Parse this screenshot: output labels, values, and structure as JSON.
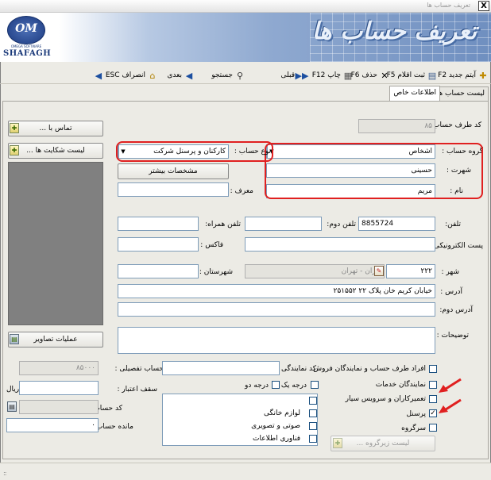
{
  "window": {
    "title": "تعریف حساب ها",
    "close_label": "X"
  },
  "banner": {
    "title": "تعریف حساب ها",
    "logo_letters": "OM",
    "logo_sub": "OMEGA SOFTWARE",
    "logo_name": "SHAFAGH"
  },
  "toolbar": {
    "items": [
      {
        "icon": "new-icon",
        "label": "آیتم جدید F2"
      },
      {
        "icon": "register-icon",
        "label": "ثبت اقلام F5"
      },
      {
        "icon": "delete-icon",
        "label": "حذف F6"
      },
      {
        "icon": "print-icon",
        "label": "چاپ F12"
      },
      {
        "icon": "prev-icon",
        "label": "قبلی"
      },
      {
        "icon": "search-icon",
        "label": "جستجو"
      },
      {
        "icon": "next-icon",
        "label": "بعدی"
      },
      {
        "icon": "cancel-icon",
        "label": "انصراف ESC"
      }
    ]
  },
  "tabs": [
    "لیست حساب ها",
    "اطلاعات خاص"
  ],
  "form": {
    "account_code_label": "کد طرف حساب :",
    "account_code_value": "۸۵",
    "account_group_label": "گروه حساب :",
    "account_group_value": "اشخاص",
    "account_type_label": "نوع حساب :",
    "account_type_value": "کارکنان و پرسنل شرکت",
    "last_name_label": "شهرت :",
    "last_name_value": "حسینی",
    "first_name_label": "نام :",
    "first_name_value": "مریم",
    "more_specs_label": "مشخصات بیشتر",
    "referrer_label": "معرف :",
    "phone_label": "تلفن:",
    "phone_value": "8855724",
    "phone2_label": "تلفن دوم:",
    "mobile_label": "تلفن همراه:",
    "email_label": "پست الکترونیکی:",
    "fax_label": "فاکس :",
    "city_label": "شهر :",
    "city_code_value": "۲۲۲",
    "city_name_value": "تهران - تهران",
    "county_label": "شهرستان :",
    "address_label": "آدرس :",
    "address_value": "خیابان کریم خان پلاک ۲۲ ۲۵۱۵۵۲",
    "address2_label": "آدرس دوم:",
    "notes_label": "توضیحات :",
    "contact_btn": "تماس با ...",
    "complaints_btn": "لیست شکایت ها ...",
    "images_btn": "عملیات تصاویر",
    "detail_code_label": "کد حساب تفصیلی :",
    "detail_code_value": "۸۵۰۰۰",
    "rep_code_label": "کد نمایندگی :",
    "credit_label": "سقف اعتبار :",
    "currency": "ریال",
    "grade1_label": "درجه یک",
    "grade2_label": "درجه دو",
    "account_code2_label": "کد حساب :",
    "balance_label": "مانده حساب :",
    "balance_value": "۰",
    "categories": [
      {
        "label": "",
        "checked": false
      },
      {
        "label": "لوازم خانگی",
        "checked": false
      },
      {
        "label": "صوتی و تصویری",
        "checked": false
      },
      {
        "label": "فناوری اطلاعات",
        "checked": false
      }
    ],
    "roles": [
      {
        "label": "افراد طرف حساب و نمایندگان فروش",
        "checked": false
      },
      {
        "label": "نمایندگان خدمات",
        "checked": false
      },
      {
        "label": "تعمیرکاران و سرویس سیار",
        "checked": false
      },
      {
        "label": "پرسنل",
        "checked": true
      },
      {
        "label": "سرگروه",
        "checked": false
      }
    ],
    "subgroup_btn": "لیست زیرگروه ..."
  },
  "status": {
    "grip": "::"
  }
}
